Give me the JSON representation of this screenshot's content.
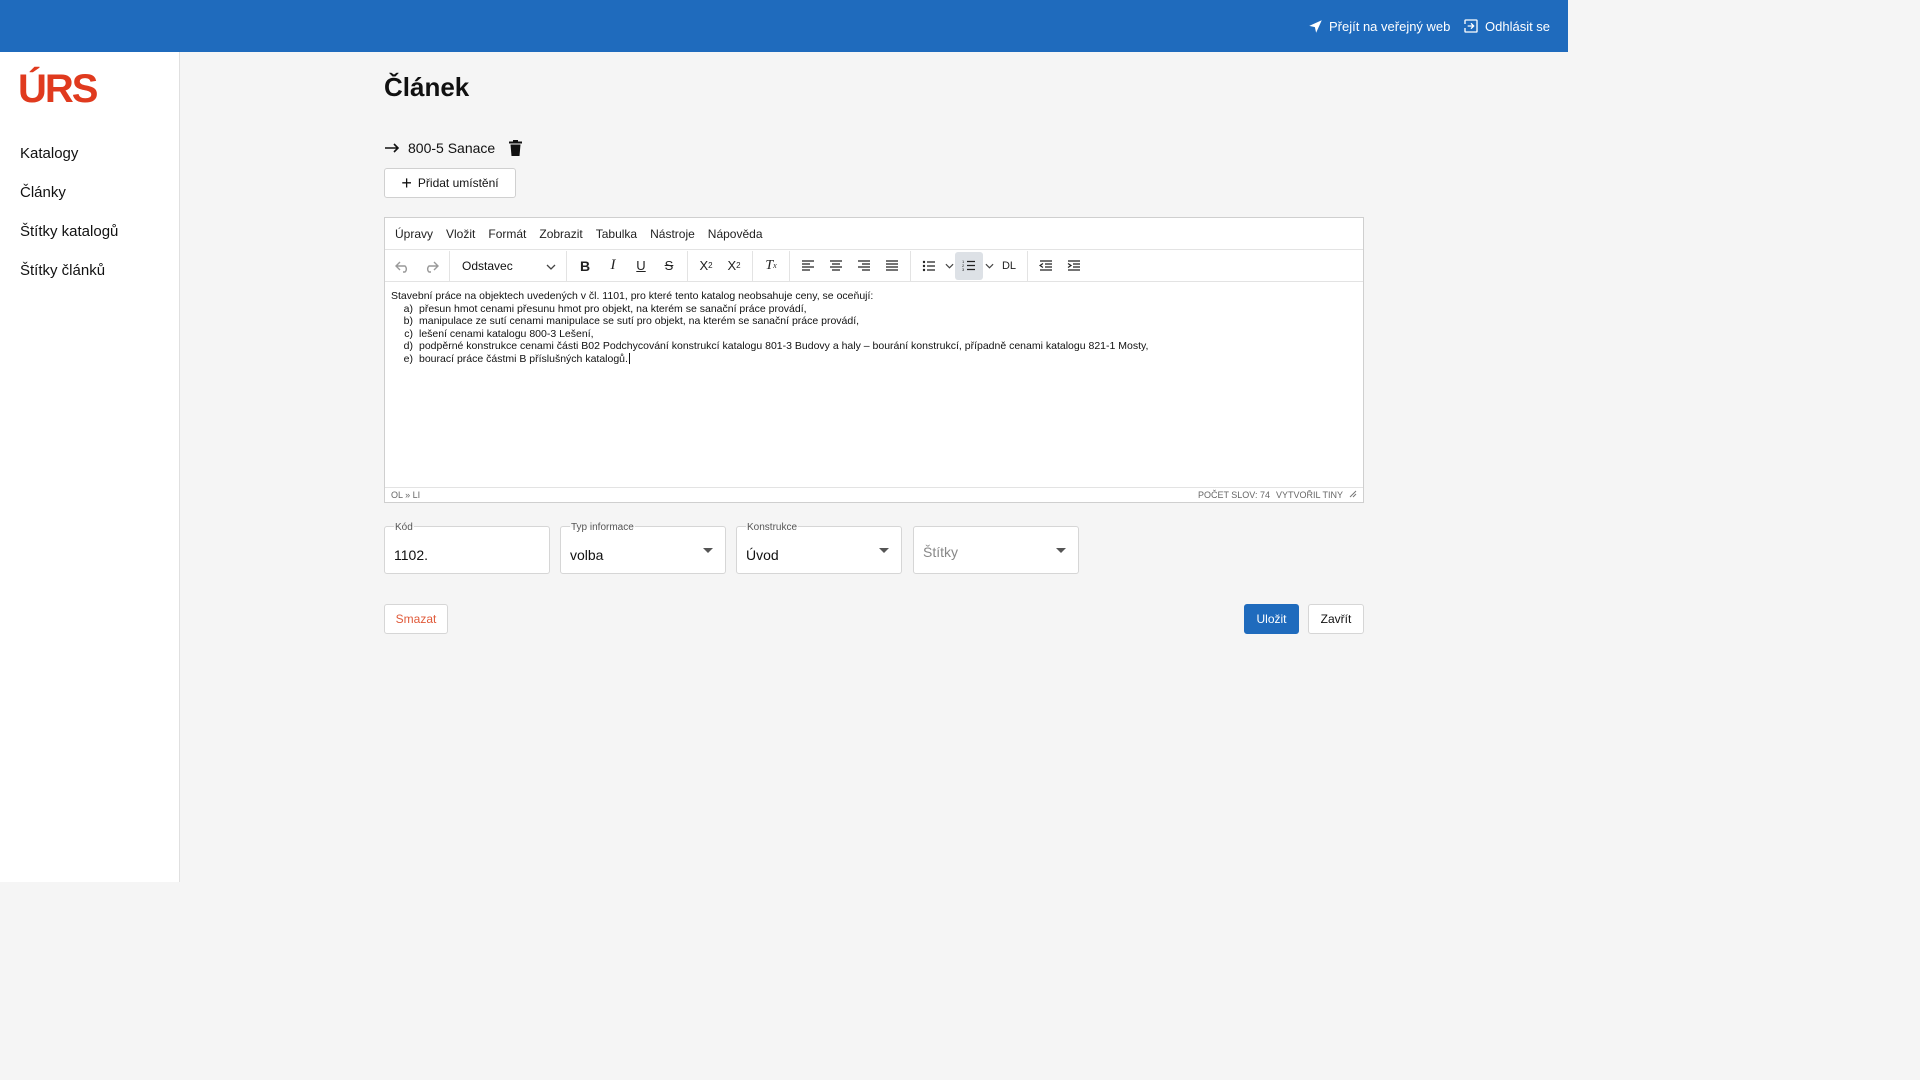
{
  "header": {
    "public_web_label": "Přejít na veřejný web",
    "logout_label": "Odhlásit se"
  },
  "sidebar": {
    "logo_text": "ÚRS",
    "items": [
      {
        "label": "Katalogy"
      },
      {
        "label": "Články"
      },
      {
        "label": "Štítky katalogů"
      },
      {
        "label": "Štítky článků"
      }
    ]
  },
  "page": {
    "title": "Článek",
    "location": "800-5 Sanace",
    "add_location_label": "Přidat umístění"
  },
  "editor": {
    "menu": [
      "Úpravy",
      "Vložit",
      "Formát",
      "Zobrazit",
      "Tabulka",
      "Nástroje",
      "Nápověda"
    ],
    "block_format": "Odstavec",
    "dl_label": "DL",
    "content": {
      "intro": "Stavební práce na objektech uvedených v čl. 1101, pro které tento katalog neobsahuje ceny, se oceňují:",
      "items": [
        {
          "marker": "a)",
          "text": "přesun hmot cenami přesunu hmot pro objekt, na kterém se sanační práce provádí,"
        },
        {
          "marker": "b)",
          "text": "manipulace ze sutí cenami manipulace se sutí pro objekt, na kterém se sanační práce provádí,"
        },
        {
          "marker": "c)",
          "text": "lešení cenami katalogu 800-3 Lešení,"
        },
        {
          "marker": "d)",
          "text": "podpěrné konstrukce cenami části B02 Podchycování konstrukcí katalogu 801-3 Budovy a haly – bourání konstrukcí, případně cenami katalogu 821-1 Mosty,"
        },
        {
          "marker": "e)",
          "text": "bourací práce částmi B příslušných katalogů."
        }
      ]
    },
    "status_path": "OL » LI",
    "word_count": "POČET SLOV: 74",
    "branding": "VYTVOŘIL TINY"
  },
  "form": {
    "code": {
      "label": "Kód",
      "value": "1102."
    },
    "info_type": {
      "label": "Typ informace",
      "value": "volba"
    },
    "construction": {
      "label": "Konstrukce",
      "value": "Úvod"
    },
    "tags": {
      "placeholder": "Štítky"
    }
  },
  "actions": {
    "delete_label": "Smazat",
    "save_label": "Uložit",
    "close_label": "Zavřít"
  },
  "colors": {
    "primary": "#1f6bbd",
    "logo": "#e03a1e",
    "danger_text": "#e05a3a"
  }
}
